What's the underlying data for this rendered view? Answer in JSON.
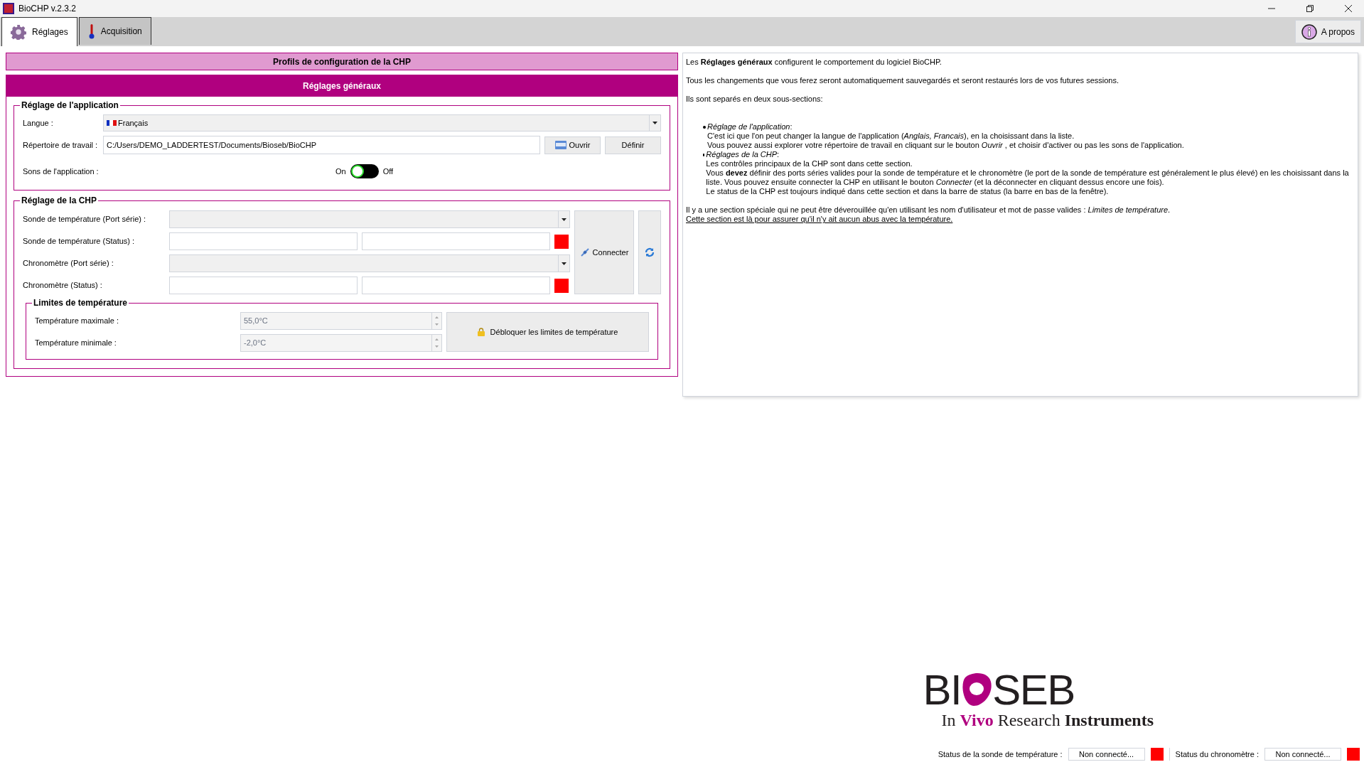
{
  "window": {
    "title": "BioCHP v.2.3.2"
  },
  "tabs": [
    {
      "label": "Réglages",
      "selected": true,
      "kind": "settings"
    },
    {
      "label": "Acquisition",
      "selected": false,
      "kind": "acquisition"
    }
  ],
  "about_button": "A propos",
  "profiles_bar": "Profils de configuration de la CHP",
  "general_header": "Réglages généraux",
  "app_settings": {
    "title": "Réglage de l'application",
    "language_label": "Langue :",
    "language_value": "Français",
    "workdir_label": "Répertoire de travail :",
    "workdir_value": "C:/Users/DEMO_LADDERTEST/Documents/Bioseb/BioCHP",
    "open_button": "Ouvrir",
    "define_button": "Définir",
    "sounds_label": "Sons de l'application :",
    "sounds_on_label": "On",
    "sounds_off_label": "Off",
    "sounds_on": true
  },
  "chp_settings": {
    "title": "Réglage de la CHP",
    "rows": [
      {
        "label": "Sonde de température (Port série) :",
        "kind": "select"
      },
      {
        "label": "Sonde de température (Status) :",
        "kind": "status",
        "color": "#ff0000"
      },
      {
        "label": "Chronomètre (Port série) :",
        "kind": "select"
      },
      {
        "label": "Chronomètre (Status) :",
        "kind": "status",
        "color": "#ff0000"
      }
    ],
    "connect_button": "Connecter",
    "limits": {
      "title": "Limites de température",
      "max_label": "Température maximale :",
      "max_value": "55,0°C",
      "min_label": "Température minimale :",
      "min_value": "-2,0°C",
      "disabled": true,
      "unlock_button": "Débloquer les limites de température"
    }
  },
  "help": {
    "paragraphs": [
      "Les **Réglages généraux** configurent le comportement du logiciel BioCHP.",
      "Tous les changements que vous ferez seront automatiquement sauvegardés et seront restaurés lors de vos futures sessions.",
      "Ils sont separés en deux sous-sections:"
    ],
    "bullets": [
      {
        "title": "*Réglage de l'application*:",
        "lines": [
          "C'est ici que l'on peut changer la langue de l'application (*Anglais, Francais*), en la choisissant dans la liste.",
          "Vous pouvez aussi explorer votre répertoire de travail en cliquant sur le bouton *Ouvrir* , et choisir d'activer ou pas les sons de l'application."
        ]
      },
      {
        "title": "*Réglages de la CHP*:",
        "lines": [
          "Les contrôles principaux de la CHP sont dans cette section.",
          "Vous **devez** définir des ports séries valides pour la sonde de température et le chronomètre (le port de la sonde de température est généralement le plus élevé) en les choisissant dans la liste. Vous pouvez ensuite connecter la CHP en utilisant le bouton *Connecter* (et la déconnecter en cliquant dessus encore une fois).",
          "Le status de la CHP est toujours indiqué dans cette section et dans la barre de status (la barre en bas de la fenêtre)."
        ]
      }
    ],
    "outro": "Il y a une section spéciale qui ne peut être déverouillée qu'en utilisant les nom d'utilisateur et mot de passe valides : *Limites de température*.",
    "note": "Cette section est là pour assurer qu'il n'y ait aucun abus avec la température."
  },
  "logo": {
    "left": "BI",
    "right": "SEB",
    "tagline": [
      {
        "text": "In",
        "kind": "plain"
      },
      {
        "text": "Vivo",
        "kind": "accent"
      },
      {
        "text": "Research",
        "kind": "plain"
      },
      {
        "text": "Instruments",
        "kind": "strong"
      }
    ]
  },
  "status_bar": [
    {
      "label": "Status de la sonde de température :",
      "value": "Non connecté...",
      "color": "#ff0000"
    },
    {
      "label": "Status du chronomètre :",
      "value": "Non connecté...",
      "color": "#ff0000"
    }
  ]
}
